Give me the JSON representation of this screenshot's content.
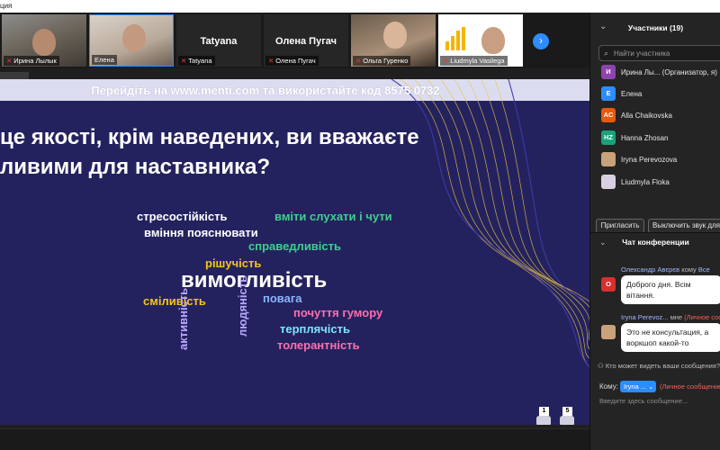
{
  "window": {
    "title_fragment": "ция"
  },
  "video_tiles": [
    {
      "caption": "Ирина Лылык",
      "muted": true
    },
    {
      "caption": "Елена",
      "muted": false
    },
    {
      "big_name": "Tatyana",
      "caption": "Tatyana",
      "muted": true
    },
    {
      "big_name": "Олена Пугач",
      "caption": "Олена Пугач",
      "muted": true
    },
    {
      "caption": "Ольга Гуренко",
      "muted": true
    },
    {
      "caption": "Liudmyla Vasilega",
      "muted": true
    }
  ],
  "next_page_icon": "chevron-right-icon",
  "slide": {
    "menti_prefix": "Перейдіть на ",
    "menti_url": "www.menti.com",
    "menti_middle": " та використайте код ",
    "menti_code": "8575 0732",
    "question_line1": "це якості, крім наведених, ви вважаєте",
    "question_line2": "ливими для наставника?",
    "words": [
      {
        "text": "стресостійкість",
        "color": "#ffffff"
      },
      {
        "text": "вміти слухати і чути",
        "color": "#3fcf8e"
      },
      {
        "text": "вміння пояснювати",
        "color": "#ffffff"
      },
      {
        "text": "справедливість",
        "color": "#3fcf8e"
      },
      {
        "text": "рішучість",
        "color": "#f5c518"
      },
      {
        "text": "вимогливість",
        "color": "#ffffff"
      },
      {
        "text": "сміливість",
        "color": "#f5c518"
      },
      {
        "text": "повага",
        "color": "#8ab4ff"
      },
      {
        "text": "почуття гумору",
        "color": "#ff6fae"
      },
      {
        "text": "терплячість",
        "color": "#7fe3ff"
      },
      {
        "text": "толерантність",
        "color": "#ff6fae"
      },
      {
        "text": "активність",
        "color": "#b8a6ff"
      },
      {
        "text": "людяність",
        "color": "#b8a6ff"
      }
    ],
    "reactions_count": "1",
    "audience_count": "5"
  },
  "participants": {
    "title": "Участники (19)",
    "search_placeholder": "Найти участника",
    "list": [
      {
        "initial": "И",
        "name": "Ирина Лы... (Организатор, я)",
        "color": "#8e44ad"
      },
      {
        "initial": "Е",
        "name": "Елена",
        "color": "#2d8cff"
      },
      {
        "initial": "AC",
        "name": "Alla Chaikovska",
        "color": "#e8590c"
      },
      {
        "initial": "HZ",
        "name": "Hanna Zhosan",
        "color": "#1aa37a"
      },
      {
        "initial": "",
        "name": "Iryna Perevozova",
        "color": "#c9a27a"
      },
      {
        "initial": "",
        "name": "Liudmyla Floka",
        "color": "#d8d0e0"
      }
    ],
    "invite_label": "Пригласить",
    "mute_all_label": "Выключить звук для в"
  },
  "chat": {
    "title": "Чат конференции",
    "messages": [
      {
        "initial": "О",
        "color": "#d63031",
        "sender": "Олександр Авєрєв",
        "to_word": " кому ",
        "recipient": "Все",
        "private": "",
        "text": "Доброго дня. Всім вітання."
      },
      {
        "initial": "",
        "color": "#c9a27a",
        "sender": "Iryna Perevoz...",
        "to_word": " мне ",
        "recipient": "",
        "private": "(Личное сооб",
        "text": "Это не консультация, а воркшоп какой-то"
      }
    ],
    "who_sees": "Кто может видеть ваши сообщения?",
    "to_label": "Кому:",
    "to_value": "Iryna ...",
    "to_private": "(Личное сообщение)",
    "compose_placeholder": "Введите здесь сообщение..."
  }
}
